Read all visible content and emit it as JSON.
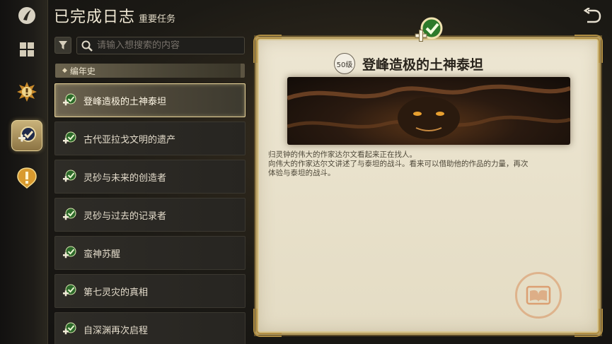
{
  "header": {
    "title": "已完成日志",
    "subtitle": "重要任务"
  },
  "rail": {
    "items": [
      "menu-grid",
      "fate-quest",
      "main-quest",
      "side-quest"
    ],
    "active_index": 2
  },
  "search": {
    "placeholder": "请输入想搜索的内容",
    "value": ""
  },
  "category": {
    "label": "编年史"
  },
  "quests": [
    {
      "label": "登峰造极的土神泰坦",
      "selected": true
    },
    {
      "label": "古代亚拉戈文明的遗产",
      "selected": false
    },
    {
      "label": "灵砂与未来的创造者",
      "selected": false
    },
    {
      "label": "灵砂与过去的记录者",
      "selected": false
    },
    {
      "label": "蛮神苏醒",
      "selected": false
    },
    {
      "label": "第七灵灾的真相",
      "selected": false
    },
    {
      "label": "自深渊再次启程",
      "selected": false
    }
  ],
  "detail": {
    "level": "50级",
    "title": "登峰造极的土神泰坦",
    "description_lines": [
      "归灵钟的伟大的作家达尔文看起来正在找人。",
      "向伟大的作家达尔文讲述了与泰坦的战斗。看来可以借助他的作品的力量，再次",
      "体验与泰坦的战斗。"
    ]
  },
  "colors": {
    "accent_gold": "#e8d49a",
    "check_green": "#3fae3a",
    "parchment": "#ede6d2"
  },
  "icons": {
    "quest_icon": "check-plus-icon",
    "back": "return-arrow-icon",
    "filter": "filter-icon",
    "search": "search-icon"
  }
}
